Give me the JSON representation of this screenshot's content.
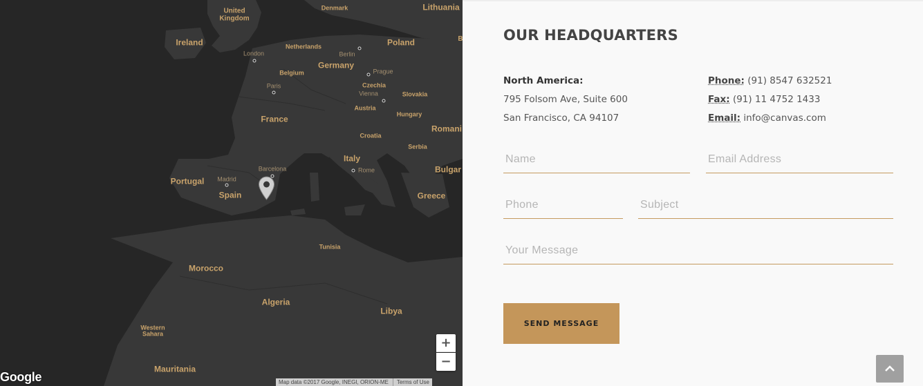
{
  "map": {
    "countries": {
      "united_kingdom": "United\nKingdom",
      "ireland": "Ireland",
      "denmark": "Denmark",
      "lithuania": "Lithuania",
      "netherlands": "Netherlands",
      "poland": "Poland",
      "belgium": "Belgium",
      "germany": "Germany",
      "czechia": "Czechia",
      "slovakia": "Slovakia",
      "austria": "Austria",
      "hungary": "Hungary",
      "france": "France",
      "croatia": "Croatia",
      "romania": "Romani",
      "serbia": "Serbia",
      "italy": "Italy",
      "bulgaria": "Bulgar",
      "portugal": "Portugal",
      "spain": "Spain",
      "greece": "Greece",
      "tunisia": "Tunisia",
      "morocco": "Morocco",
      "algeria": "Algeria",
      "libya": "Libya",
      "western_sahara": "Western\nSahara",
      "mauritania": "Mauritania",
      "belarus_partial": "B"
    },
    "cities": {
      "london": "London",
      "berlin": "Berlin",
      "prague": "Prague",
      "paris": "Paris",
      "vienna": "Vienna",
      "barcelona": "Barcelona",
      "madrid": "Madrid",
      "rome": "Rome"
    },
    "controls": {
      "zoom_in": "+",
      "zoom_out": "−"
    },
    "google_logo": "Google",
    "attribution": "Map data ©2017 Google, INEGI, ORION-ME",
    "terms": "Terms of Use",
    "colors": {
      "land": "#383838",
      "water": "#262626",
      "label": "#c9a36b",
      "city_label": "#a59070"
    },
    "icons": {
      "pin": "map-pin-icon"
    }
  },
  "panel": {
    "title": "OUR HEADQUARTERS",
    "address": {
      "region": "North America:",
      "line1": "795 Folsom Ave, Suite 600",
      "line2": "San Francisco, CA 94107"
    },
    "contact": {
      "phone_label": "Phone:",
      "phone": "(91) 8547 632521",
      "fax_label": "Fax:",
      "fax": "(91) 11 4752 1433",
      "email_label": "Email:",
      "email": "info@canvas.com"
    },
    "form": {
      "name_placeholder": "Name",
      "email_placeholder": "Email Address",
      "phone_placeholder": "Phone",
      "subject_placeholder": "Subject",
      "message_placeholder": "Your Message",
      "submit_label": "SEND MESSAGE"
    },
    "accent_color": "#c4965a",
    "scroll_top_icon": "chevron-up-icon"
  }
}
